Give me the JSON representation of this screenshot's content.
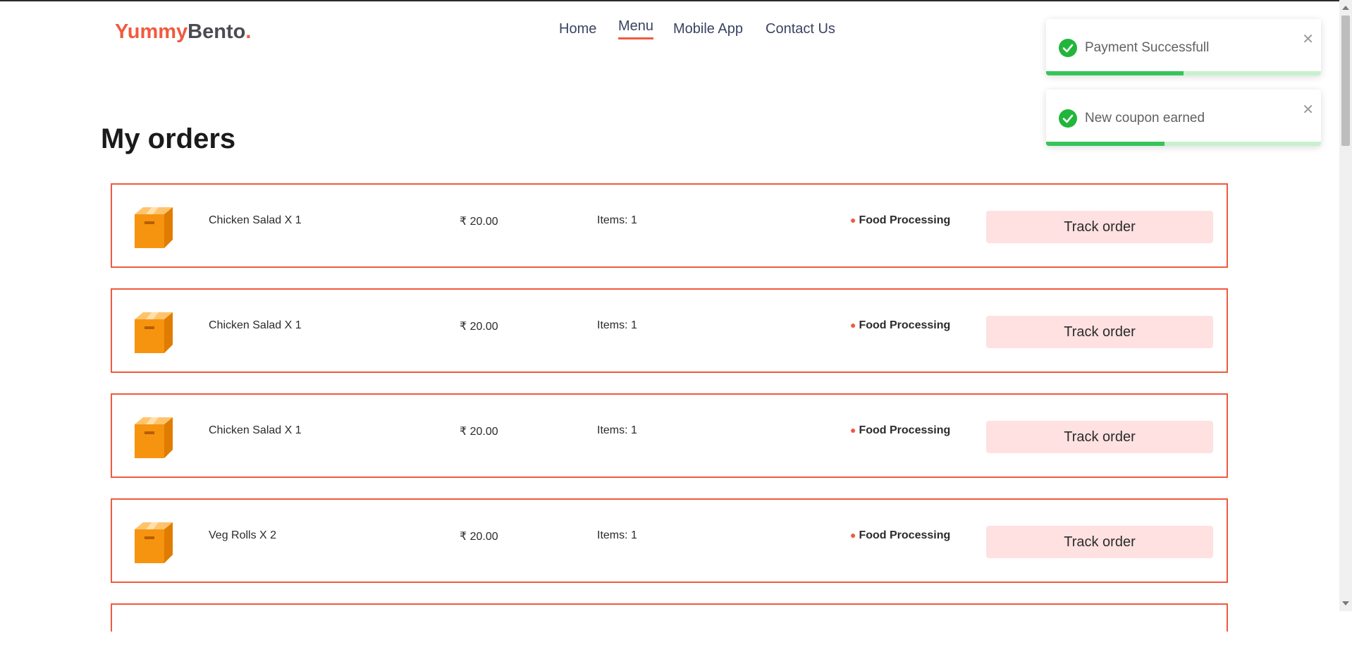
{
  "brand": {
    "part1": "Yummy",
    "part2": "Bento",
    "dot": "."
  },
  "nav": {
    "items": [
      "Home",
      "Menu",
      "Mobile App",
      "Contact Us"
    ],
    "active": "Menu"
  },
  "page_title": "My orders",
  "orders": [
    {
      "name": "Chicken Salad X 1",
      "price": "₹ 20.00",
      "items": "Items: 1",
      "status": "Food Processing",
      "button": "Track order"
    },
    {
      "name": "Chicken Salad X 1",
      "price": "₹ 20.00",
      "items": "Items: 1",
      "status": "Food Processing",
      "button": "Track order"
    },
    {
      "name": "Chicken Salad X 1",
      "price": "₹ 20.00",
      "items": "Items: 1",
      "status": "Food Processing",
      "button": "Track order"
    },
    {
      "name": "Veg Rolls X 2",
      "price": "₹ 20.00",
      "items": "Items: 1",
      "status": "Food Processing",
      "button": "Track order"
    }
  ],
  "toasts": [
    {
      "message": "Payment Successfull",
      "progress": 0.5,
      "icon": "check-circle-icon"
    },
    {
      "message": "New coupon earned",
      "progress": 0.43,
      "icon": "check-circle-icon"
    }
  ],
  "colors": {
    "accent": "#f05a3f",
    "nav_text": "#3a4362",
    "button_bg": "#ffe1e1",
    "success": "#37c45a",
    "box": "#f7940f"
  }
}
